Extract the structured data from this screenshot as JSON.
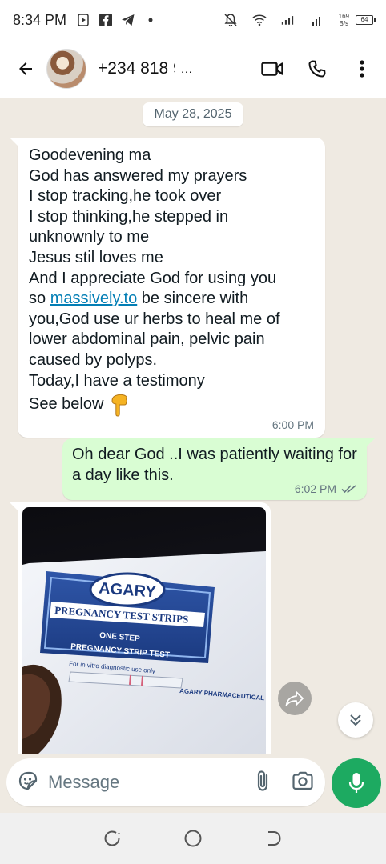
{
  "status_bar": {
    "time": "8:34 PM",
    "net_speed_value": "169",
    "net_speed_unit": "B/s",
    "battery": "64"
  },
  "header": {
    "contact_name": "+234 818 9",
    "ellipsis": "..."
  },
  "chat": {
    "date_chip": "May 28, 2025",
    "incoming": {
      "lines": [
        "Goodevening ma",
        "God has answered my prayers",
        "I stop tracking,he took over",
        "I stop thinking,he stepped in",
        "unknownly to me",
        "Jesus stil loves me",
        "And I appreciate God for using you"
      ],
      "link_prefix": "so ",
      "link_text": "massively.to",
      "link_suffix": " be sincere with",
      "lines_after": [
        "you,God use ur herbs to heal me of",
        "lower abdominal pain, pelvic pain",
        "caused by polyps.",
        "Today,I have a testimony"
      ],
      "see_below": "See below",
      "time": "6:00 PM"
    },
    "outgoing": {
      "text": "Oh dear God ..I was patiently waiting for a day like this.",
      "time": "6:02 PM"
    },
    "image_message": {
      "brand": "AGARY",
      "title": "PREGNANCY TEST STRIPS",
      "subtitle_1": "ONE STEP",
      "subtitle_2": "PREGNANCY STRIP TEST",
      "note": "For in vitro diagnostic use only",
      "maker": "AGARY PHARMACEUTICAL"
    }
  },
  "composer": {
    "placeholder": "Message"
  },
  "colors": {
    "outgoing_bubble": "#d9fdd3",
    "chat_background": "#efeae2",
    "accent_green": "#1daa61",
    "link": "#027eb5"
  }
}
